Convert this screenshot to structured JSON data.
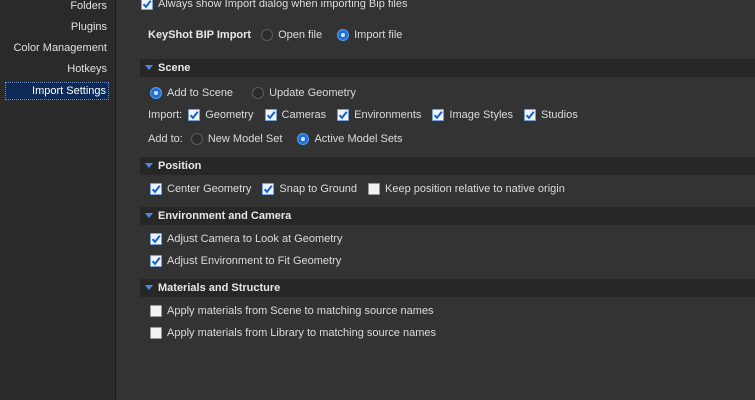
{
  "sidebar": {
    "items": [
      "Folders",
      "Plugins",
      "Color Management",
      "Hotkeys",
      "Import Settings"
    ],
    "selected": "Import Settings"
  },
  "top": {
    "always_show_label": "Always show Import dialog when importing Bip files"
  },
  "bip_import": {
    "label": "KeyShot BIP Import",
    "options": [
      "Open file",
      "Import file"
    ],
    "selected": "Import file"
  },
  "scene": {
    "title": "Scene",
    "mode_options": [
      "Add to Scene",
      "Update Geometry"
    ],
    "mode_selected": "Add to Scene",
    "import_label": "Import:",
    "import_items": [
      "Geometry",
      "Cameras",
      "Environments",
      "Image Styles",
      "Studios"
    ],
    "add_to_label": "Add to:",
    "add_to_options": [
      "New Model Set",
      "Active Model Sets"
    ],
    "add_to_selected": "Active Model Sets"
  },
  "position": {
    "title": "Position",
    "items": [
      "Center Geometry",
      "Snap to Ground",
      "Keep position relative to native origin"
    ],
    "checked": [
      true,
      true,
      false
    ]
  },
  "environment_camera": {
    "title": "Environment and Camera",
    "items": [
      "Adjust Camera to Look at Geometry",
      "Adjust Environment to Fit Geometry"
    ],
    "checked": [
      true,
      true
    ]
  },
  "materials": {
    "title": "Materials and Structure",
    "items": [
      "Apply materials from Scene to matching source names",
      "Apply materials from Library to matching source names"
    ],
    "checked": [
      false,
      false
    ]
  },
  "colors": {
    "accent": "#1f6fd8",
    "panel": "#333333",
    "header": "#272727",
    "sidebar": "#2a2a2a",
    "selection": "#0d2a57"
  }
}
